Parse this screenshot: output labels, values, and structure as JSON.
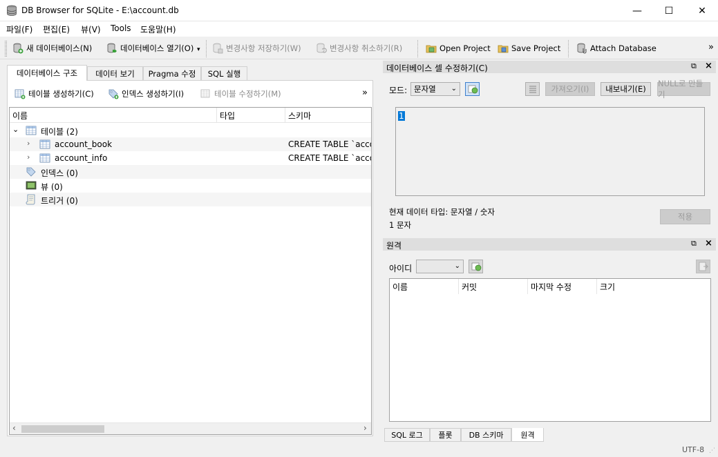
{
  "window": {
    "title": "DB Browser for SQLite - E:\\account.db",
    "minimize_glyph": "—",
    "maximize_glyph": "☐",
    "close_glyph": "✕"
  },
  "menu": [
    "파일(F)",
    "편집(E)",
    "뷰(V)",
    "Tools",
    "도움말(H)"
  ],
  "toolbar": {
    "new_db": "새 데이터베이스(N)",
    "open_db": "데이터베이스 열기(O)",
    "write_changes": "변경사항 저장하기(W)",
    "revert_changes": "변경사항 취소하기(R)",
    "open_project": "Open Project",
    "save_project": "Save Project",
    "attach_db": "Attach Database",
    "overflow": "»"
  },
  "main_tabs": [
    "데이터베이스 구조",
    "데이터 보기",
    "Pragma 수정",
    "SQL 실행"
  ],
  "structure": {
    "create_table": "테이블 생성하기(C)",
    "create_index": "인덱스 생성하기(I)",
    "modify_table": "테이블 수정하기(M)",
    "overflow": "»",
    "columns": [
      "이름",
      "타입",
      "스키마"
    ],
    "tables_label": "테이블 (2)",
    "tables": [
      {
        "name": "account_book",
        "schema": "CREATE TABLE `account_book`"
      },
      {
        "name": "account_info",
        "schema": "CREATE TABLE `account_info`"
      }
    ],
    "indexes_label": "인덱스 (0)",
    "views_label": "뷰 (0)",
    "triggers_label": "트리거 (0)"
  },
  "edit_cell": {
    "title": "데이터베이스 셀 수정하기(C)",
    "mode_label": "모드:",
    "mode_value": "문자열",
    "import_label": "가져오기(I)",
    "export_label": "내보내기(E)",
    "set_null_label": "NULL로 만들기",
    "content": "1",
    "type_info": "현재 데이터 타입: 문자열 / 숫자",
    "size_info": "1 문자",
    "apply_label": "적용"
  },
  "remote": {
    "title": "원격",
    "identity_label": "아이디",
    "identity_value": "",
    "columns": [
      "이름",
      "커밋",
      "마지막 수정",
      "크기"
    ]
  },
  "bottom_tabs": [
    "SQL 로그",
    "플롯",
    "DB 스키마",
    "원격"
  ],
  "status": {
    "encoding": "UTF-8"
  },
  "colors": {
    "accent": "#0078d7",
    "selection": "#0078d7",
    "header_bg": "#dedede"
  }
}
